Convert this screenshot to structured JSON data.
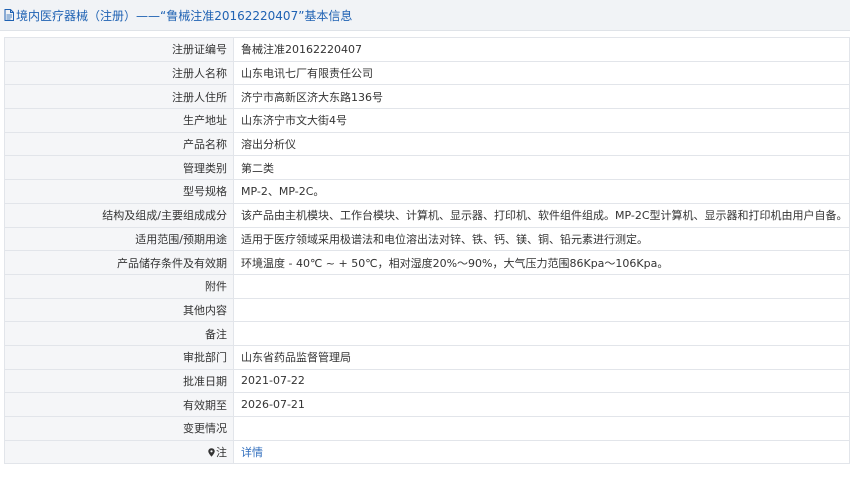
{
  "header": {
    "title": "境内医疗器械（注册）——“鲁械注准20162220407”基本信息"
  },
  "rows": [
    {
      "label": "注册证编号",
      "value": "鲁械注准20162220407"
    },
    {
      "label": "注册人名称",
      "value": "山东电讯七厂有限责任公司"
    },
    {
      "label": "注册人住所",
      "value": "济宁市高新区济大东路136号"
    },
    {
      "label": "生产地址",
      "value": "山东济宁市文大街4号"
    },
    {
      "label": "产品名称",
      "value": "溶出分析仪"
    },
    {
      "label": "管理类别",
      "value": "第二类"
    },
    {
      "label": "型号规格",
      "value": "MP-2、MP-2C。"
    },
    {
      "label": "结构及组成/主要组成成分",
      "value": "该产品由主机模块、工作台模块、计算机、显示器、打印机、软件组件组成。MP-2C型计算机、显示器和打印机由用户自备。"
    },
    {
      "label": "适用范围/预期用途",
      "value": "适用于医疗领域采用极谱法和电位溶出法对锌、铁、钙、镁、铜、铅元素进行测定。"
    },
    {
      "label": "产品储存条件及有效期",
      "value": "环境温度 - 40℃ ~ + 50℃，相对湿度20%～90%，大气压力范围86Kpa～106Kpa。"
    },
    {
      "label": "附件",
      "value": ""
    },
    {
      "label": "其他内容",
      "value": ""
    },
    {
      "label": "备注",
      "value": ""
    },
    {
      "label": "审批部门",
      "value": "山东省药品监督管理局"
    },
    {
      "label": "批准日期",
      "value": "2021-07-22"
    },
    {
      "label": "有效期至",
      "value": "2026-07-21"
    },
    {
      "label": "变更情况",
      "value": ""
    }
  ],
  "note": {
    "label": "注",
    "icon": "location-pin-icon",
    "link_label": "详情"
  }
}
